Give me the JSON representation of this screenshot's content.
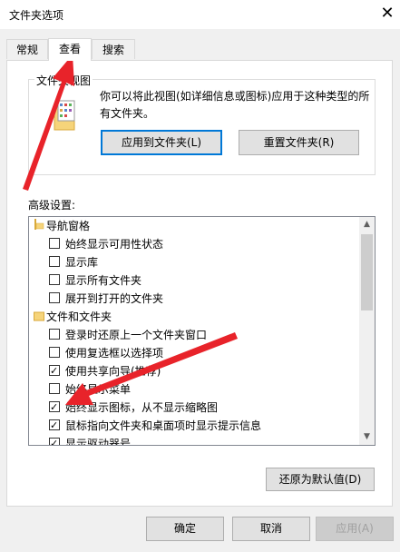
{
  "window": {
    "title": "文件夹选项",
    "close_glyph": "✕"
  },
  "tabs": [
    {
      "label": "常规"
    },
    {
      "label": "查看"
    },
    {
      "label": "搜索"
    }
  ],
  "folder_views": {
    "group_label": "文件夹视图",
    "description": "你可以将此视图(如详细信息或图标)应用于这种类型的所有文件夹。",
    "apply_button": "应用到文件夹(L)",
    "reset_button": "重置文件夹(R)"
  },
  "advanced": {
    "label": "高级设置:",
    "items": [
      {
        "type": "group",
        "label": "导航窗格",
        "icon": "navigation-pane-icon"
      },
      {
        "type": "checkbox",
        "label": "始终显示可用性状态",
        "checked": false
      },
      {
        "type": "checkbox",
        "label": "显示库",
        "checked": false
      },
      {
        "type": "checkbox",
        "label": "显示所有文件夹",
        "checked": false
      },
      {
        "type": "checkbox",
        "label": "展开到打开的文件夹",
        "checked": false
      },
      {
        "type": "group",
        "label": "文件和文件夹",
        "icon": "folder-icon"
      },
      {
        "type": "checkbox",
        "label": "登录时还原上一个文件夹窗口",
        "checked": false
      },
      {
        "type": "checkbox",
        "label": "使用复选框以选择项",
        "checked": false
      },
      {
        "type": "checkbox",
        "label": "使用共享向导(推荐)",
        "checked": true
      },
      {
        "type": "checkbox",
        "label": "始终显示菜单",
        "checked": false
      },
      {
        "type": "checkbox",
        "label": "始终显示图标，从不显示缩略图",
        "checked": true
      },
      {
        "type": "checkbox",
        "label": "鼠标指向文件夹和桌面项时显示提示信息",
        "checked": true
      },
      {
        "type": "checkbox",
        "label": "显示驱动器号",
        "checked": true
      }
    ],
    "restore_button": "还原为默认值(D)"
  },
  "footer": {
    "ok": "确定",
    "cancel": "取消",
    "apply": "应用(A)"
  },
  "colors": {
    "annotation_arrow": "#e8232a",
    "focus_border": "#0078d7"
  }
}
